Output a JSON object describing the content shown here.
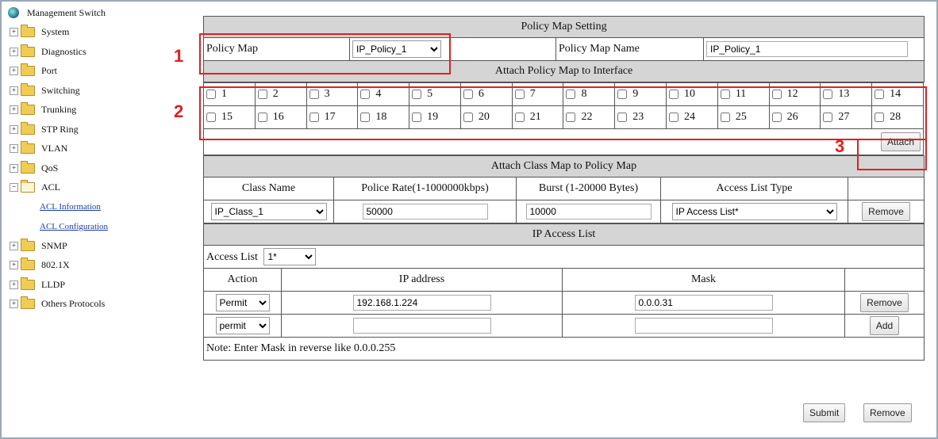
{
  "sidebar": {
    "root": "Management Switch",
    "items": [
      "System",
      "Diagnostics",
      "Port",
      "Switching",
      "Trunking",
      "STP Ring",
      "VLAN",
      "QoS",
      "ACL"
    ],
    "acl_children": [
      "ACL Information",
      "ACL Configuration"
    ],
    "items_after": [
      "SNMP",
      "802.1X",
      "LLDP",
      "Others Protocols"
    ]
  },
  "policy_map_setting": {
    "title": "Policy Map Setting",
    "policy_map_label": "Policy Map",
    "policy_map_value": "IP_Policy_1",
    "policy_map_name_label": "Policy Map Name",
    "policy_map_name_value": "IP_Policy_1"
  },
  "attach_interface": {
    "title": "Attach Policy Map to Interface",
    "row1": [
      "1",
      "2",
      "3",
      "4",
      "5",
      "6",
      "7",
      "8",
      "9",
      "10",
      "11",
      "12",
      "13",
      "14"
    ],
    "row2": [
      "15",
      "16",
      "17",
      "18",
      "19",
      "20",
      "21",
      "22",
      "23",
      "24",
      "25",
      "26",
      "27",
      "28"
    ],
    "attach_button": "Attach"
  },
  "class_map": {
    "title": "Attach Class Map to Policy Map",
    "headers": [
      "Class Name",
      "Police Rate(1-1000000kbps)",
      "Burst (1-20000 Bytes)",
      "Access List Type"
    ],
    "class_name": "IP_Class_1",
    "police_rate": "50000",
    "burst": "10000",
    "access_list_type": "IP Access List*",
    "remove_button": "Remove"
  },
  "ip_access_list": {
    "title": "IP Access List",
    "access_list_label": "Access List",
    "access_list_value": "1*",
    "headers": [
      "Action",
      "IP address",
      "Mask"
    ],
    "rows": [
      {
        "action": "Permit",
        "ip": "192.168.1.224",
        "mask": "0.0.0.31",
        "button": "Remove"
      },
      {
        "action": "permit",
        "ip": "",
        "mask": "",
        "button": "Add"
      }
    ],
    "note": "Note: Enter Mask in reverse like 0.0.0.255"
  },
  "footer": {
    "submit": "Submit",
    "remove": "Remove"
  },
  "markers": [
    "1",
    "2",
    "3"
  ],
  "colors": {
    "highlight": "#e02020",
    "header_bg": "#d5d5d5",
    "link": "#1a3fa8"
  }
}
